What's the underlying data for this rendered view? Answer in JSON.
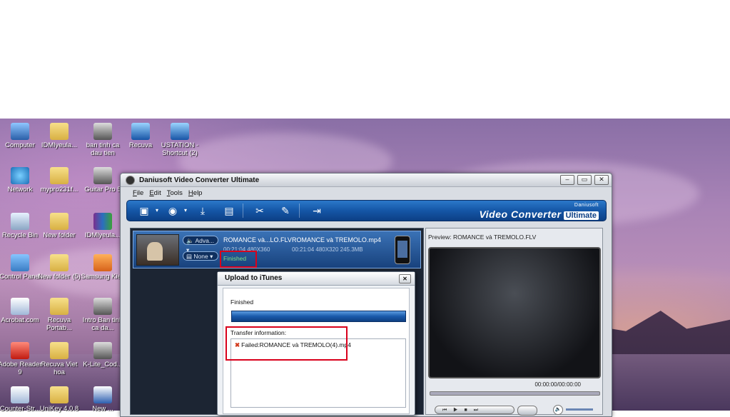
{
  "desktop": {
    "icons": [
      {
        "label": "Computer",
        "glyph": "g-pc"
      },
      {
        "label": "IDMlyeula...",
        "glyph": "g-folder"
      },
      {
        "label": "ban tinh ca dau tien",
        "glyph": "g-app"
      },
      {
        "label": "Recuva",
        "glyph": "g-blue"
      },
      {
        "label": "USTATION - Shortcut (2)",
        "glyph": "g-blue"
      },
      {
        "label": "Network",
        "glyph": "g-net"
      },
      {
        "label": "mypro231f...",
        "glyph": "g-folder"
      },
      {
        "label": "Guitar Pro 5",
        "glyph": "g-app"
      },
      {
        "label": "Recycle Bin",
        "glyph": "g-bin"
      },
      {
        "label": "New folder",
        "glyph": "g-folder"
      },
      {
        "label": "IDMlyeula...",
        "glyph": "g-rar"
      },
      {
        "label": "Control Panel",
        "glyph": "g-cp"
      },
      {
        "label": "New folder (5)",
        "glyph": "g-folder"
      },
      {
        "label": "Samsung Kies",
        "glyph": "g-orange"
      },
      {
        "label": "Acrobat.com",
        "glyph": "g-doc"
      },
      {
        "label": "Recuva Portab...",
        "glyph": "g-folder"
      },
      {
        "label": "Intro Ban tinh ca da...",
        "glyph": "g-app"
      },
      {
        "label": "Adobe Reader 9",
        "glyph": "g-red"
      },
      {
        "label": "Recuva Viet hoa",
        "glyph": "g-folder"
      },
      {
        "label": "K-Lite_Cod...",
        "glyph": "g-app"
      },
      {
        "label": "Counter-Str...",
        "glyph": "g-doc"
      },
      {
        "label": "UniKey 4.0.8",
        "glyph": "g-folder"
      },
      {
        "label": "New ...",
        "glyph": "g-word"
      }
    ]
  },
  "window": {
    "title": "Daniusoft Video Converter Ultimate",
    "controls": [
      "minimize",
      "maximize",
      "close"
    ],
    "menu": [
      "File",
      "Edit",
      "Tools",
      "Help"
    ],
    "toolbar": {
      "buttons": [
        "add-file-icon",
        "add-dvd-icon",
        "download-icon",
        "snapshot-icon",
        "cut-icon",
        "edit-icon",
        "export-icon"
      ],
      "brand_small": "Daniusoft",
      "brand_big": "Video Converter",
      "brand_badge": "Ultimate"
    },
    "file": {
      "audio_option": "Adva...",
      "subtitle_option": "None",
      "source_name": "ROMANCE và...LO.FLV",
      "source_meta": "00:21:04   480X360",
      "status": "Finished",
      "output_name": "ROMANCE và TREMOLO.mp4",
      "output_meta": "00:21:04   480X320   245.3MB"
    },
    "preview": {
      "title": "Preview: ROMANCE và TREMOLO.FLV",
      "time": "00:00:00/00:00:00"
    }
  },
  "dialog": {
    "title": "Upload to iTunes",
    "status": "Finished",
    "progress": 1.0,
    "transfer_label": "Transfer information:",
    "log": [
      "Failed:ROMANCE và TREMOLO(4).mp4"
    ]
  }
}
